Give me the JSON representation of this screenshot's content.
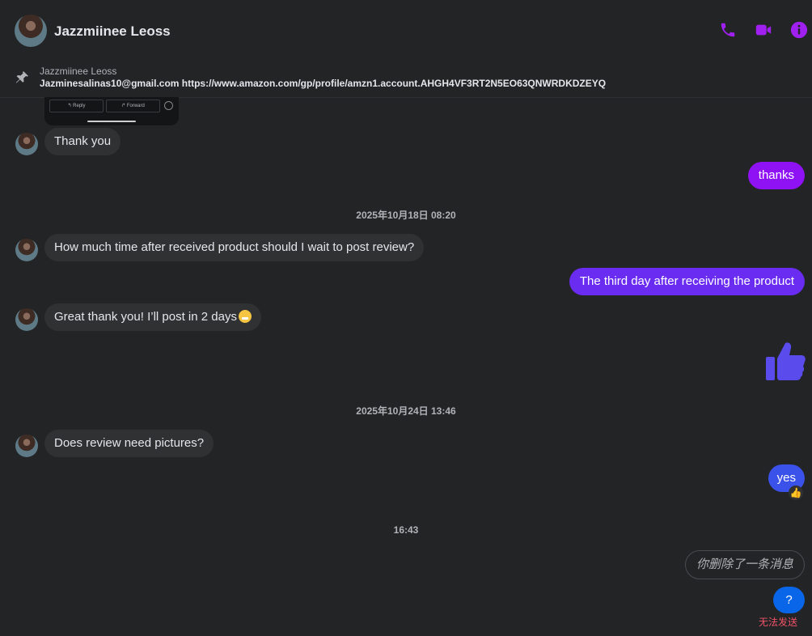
{
  "header": {
    "contact_name": "Jazzmiinee Leoss",
    "icons": [
      "phone-icon",
      "video-call-icon",
      "info-icon"
    ],
    "accent_color": "#a020f0"
  },
  "pinned": {
    "sender": "Jazzmiinee Leoss",
    "text": "Jazminesalinas10@gmail.com https://www.amazon.com/gp/profile/amzn1.account.AHGH4VF3RT2N5EO63QNWRDKDZEYQ"
  },
  "image_preview": {
    "reply_label": "↰ Reply",
    "forward_label": "↱ Forward"
  },
  "messages": [
    {
      "from": "them",
      "text": "Thank you"
    },
    {
      "from": "me",
      "text": "thanks",
      "color": "#8f12f5"
    },
    {
      "type": "timestamp",
      "text": "2025年10月18日 08:20"
    },
    {
      "from": "them",
      "text": "How much time after received product should I wait to post review?"
    },
    {
      "from": "me",
      "text": "The third day after receiving the product",
      "color": "#6a2cf0"
    },
    {
      "from": "them",
      "text": "Great thank you! I’ll post in 2 days",
      "emoji": "grinning-face-emoji"
    },
    {
      "from": "me",
      "type": "like",
      "icon": "thumbs-up-icon",
      "color": "#5a4bec"
    },
    {
      "type": "timestamp",
      "text": "2025年10月24日 13:46"
    },
    {
      "from": "them",
      "text": "Does review need pictures?"
    },
    {
      "from": "me",
      "text": "yes",
      "color": "#3a51ea",
      "reaction": "👍"
    },
    {
      "type": "timestamp",
      "text": "16:43"
    },
    {
      "from": "me",
      "type": "deleted",
      "text": "你删除了一条消息"
    },
    {
      "from": "me",
      "text": "?",
      "color": "#0a66e8",
      "status": "无法发送"
    }
  ]
}
